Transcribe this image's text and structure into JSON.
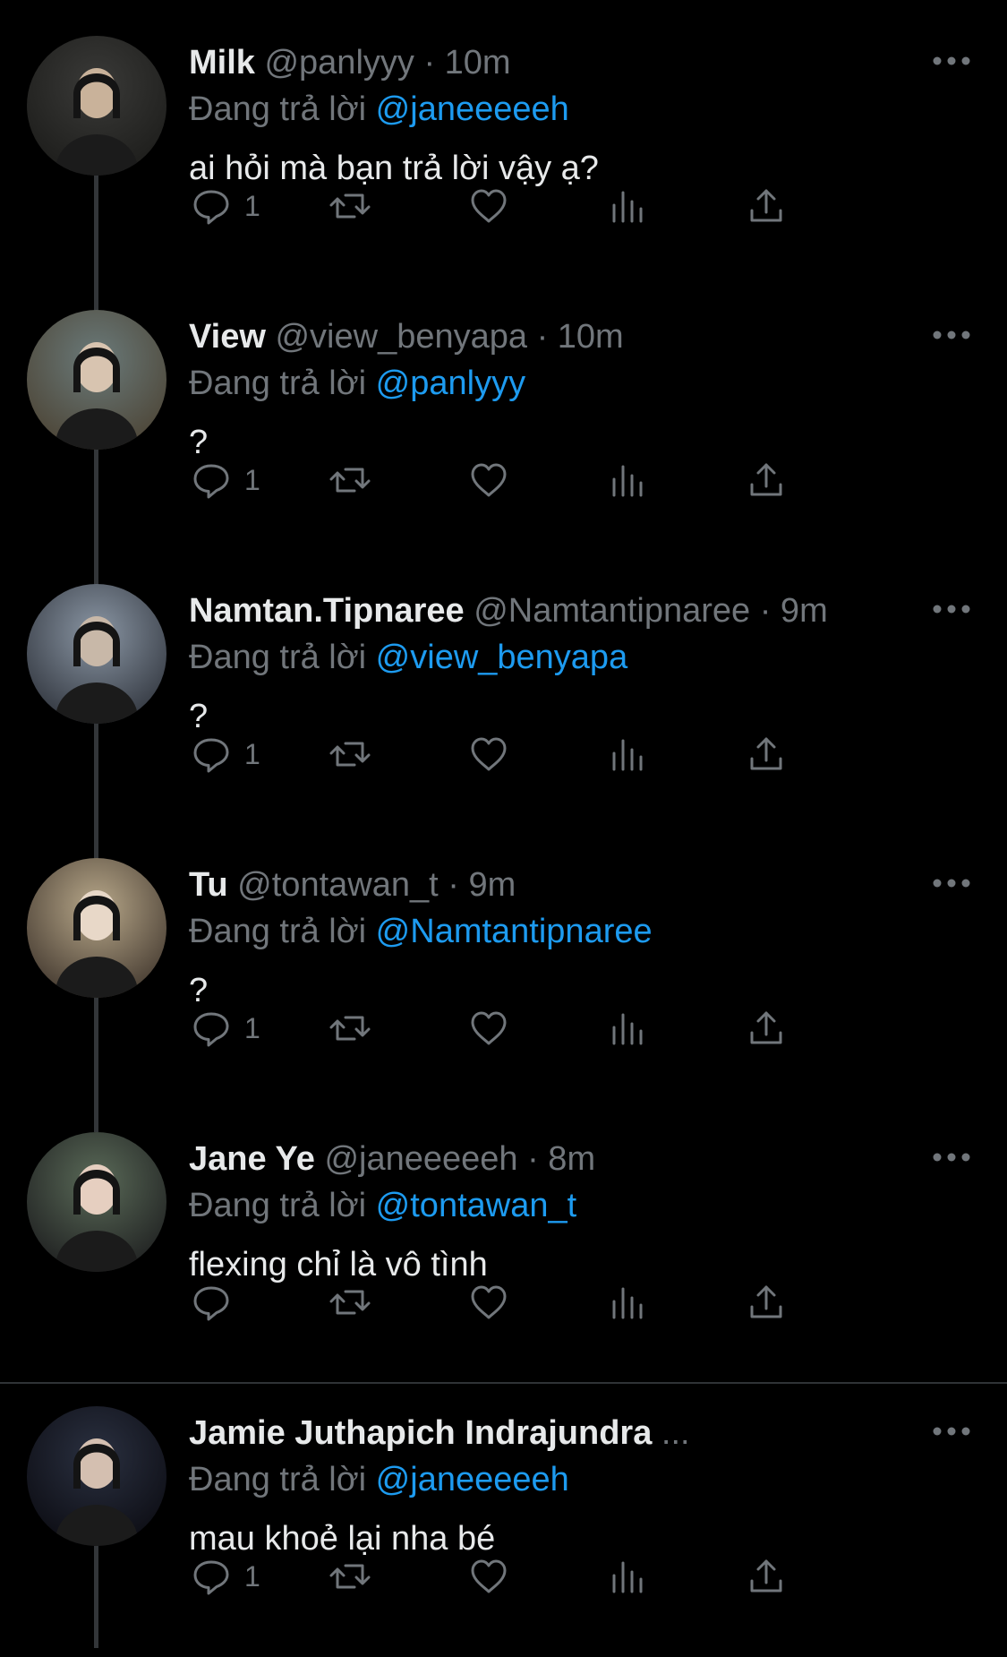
{
  "theme": {
    "background": "#000000",
    "text": "#e7e9ea",
    "muted": "#71767b",
    "accent": "#1d9bf0",
    "thread": "#333639"
  },
  "reply_prefix": "Đang trả lời",
  "tweets": [
    {
      "name": "Milk",
      "handle": "@panlyyy",
      "time": "· 10m",
      "reply_to": "@janeeeeeh",
      "text": "ai hỏi mà bạn trả lời vậy ạ?",
      "reply_count": "1",
      "avatar_icon": "avatar-photo"
    },
    {
      "name": "View",
      "handle": "@view_benyapa",
      "time": "· 10m",
      "reply_to": "@panlyyy",
      "text": "?",
      "reply_count": "1",
      "avatar_icon": "avatar-photo"
    },
    {
      "name": "Namtan.Tipnaree",
      "handle": "@Namtantipnaree",
      "time": "· 9m",
      "reply_to": "@view_benyapa",
      "text": "?",
      "reply_count": "1",
      "avatar_icon": "avatar-photo"
    },
    {
      "name": "Tu",
      "handle": "@tontawan_t",
      "time": "· 9m",
      "reply_to": "@Namtantipnaree",
      "text": "?",
      "reply_count": "1",
      "avatar_icon": "avatar-photo"
    },
    {
      "name": "Jane Ye",
      "handle": "@janeeeeeh",
      "time": "· 8m",
      "reply_to": "@tontawan_t",
      "text": "flexing chỉ là vô tình",
      "reply_count": "",
      "avatar_icon": "avatar-photo"
    },
    {
      "name": "Jamie Juthapich Indrajundra",
      "handle": "...",
      "time": "",
      "reply_to": "@janeeeeeh",
      "text": "mau khoẻ lại nha bé",
      "reply_count": "1",
      "avatar_icon": "avatar-photo"
    }
  ],
  "icons": {
    "more": "more-horizontal-icon",
    "reply": "reply-bubble-icon",
    "retweet": "retweet-icon",
    "like": "heart-icon",
    "views": "views-bar-chart-icon",
    "share": "share-upload-icon"
  }
}
